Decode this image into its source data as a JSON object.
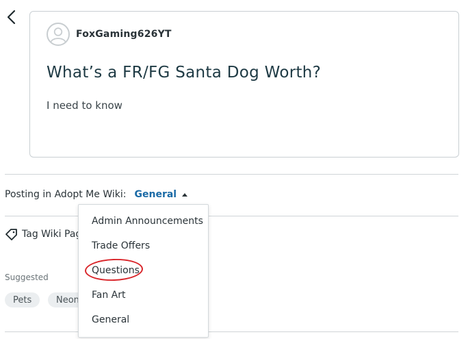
{
  "post": {
    "author": "FoxGaming626YT",
    "title": "What’s a FR/FG Santa Dog Worth?",
    "body": "I need to know"
  },
  "posting": {
    "label": "Posting in Adopt Me Wiki:",
    "selected": "General"
  },
  "tag": {
    "label": "Tag Wiki Pages"
  },
  "suggested": {
    "label": "Suggested",
    "chips": [
      "Pets",
      "Neon"
    ]
  },
  "dropdown": {
    "items": [
      "Admin Announcements",
      "Trade Offers",
      "Questions",
      "Fan Art",
      "General"
    ]
  },
  "colors": {
    "link_blue": "#1a6aa6",
    "highlight_red": "#d9262b"
  }
}
